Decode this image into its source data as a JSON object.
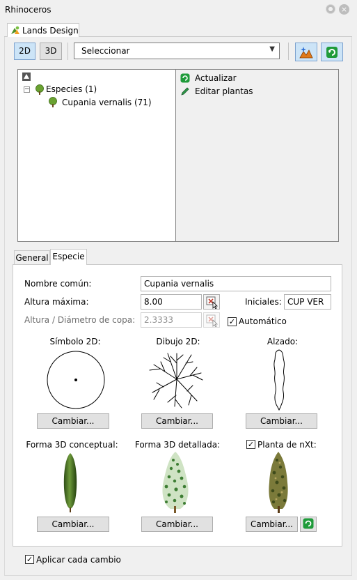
{
  "window": {
    "title": "Rhinoceros"
  },
  "doc_tab": {
    "label": "Lands Design"
  },
  "toolbar": {
    "btn_2d": "2D",
    "btn_3d": "3D",
    "mode_select": "Seleccionar"
  },
  "tree": {
    "root_label": "Especies (1)",
    "child_label": "Cupania vernalis (71)"
  },
  "commands": {
    "update": "Actualizar",
    "edit": "Editar plantas"
  },
  "tabs": {
    "general": "General",
    "especie": "Especie"
  },
  "form": {
    "common_name_label": "Nombre común:",
    "common_name_value": "Cupania vernalis",
    "max_height_label": "Altura máxima:",
    "max_height_value": "8.00",
    "initials_label": "Iniciales:",
    "initials_value": "CUP VER",
    "ratio_label": "Altura / Diámetro de copa:",
    "ratio_value": "2.3333",
    "auto_label": "Automático",
    "auto_checked": true
  },
  "previews": {
    "symbol2d": "Símbolo 2D:",
    "drawing2d": "Dibujo 2D:",
    "elevation": "Alzado:",
    "conceptual3d": "Forma 3D conceptual:",
    "detailed3d": "Forma 3D detallada:",
    "nxt": "Planta de nXt:",
    "nxt_checked": true,
    "change_label": "Cambiar..."
  },
  "footer": {
    "apply_label": "Aplicar cada cambio",
    "apply_checked": true
  },
  "colors": {
    "selected_btn": "#cce4f7",
    "tree_green": "#5a9a2a",
    "update_green": "#1f9b3a"
  }
}
